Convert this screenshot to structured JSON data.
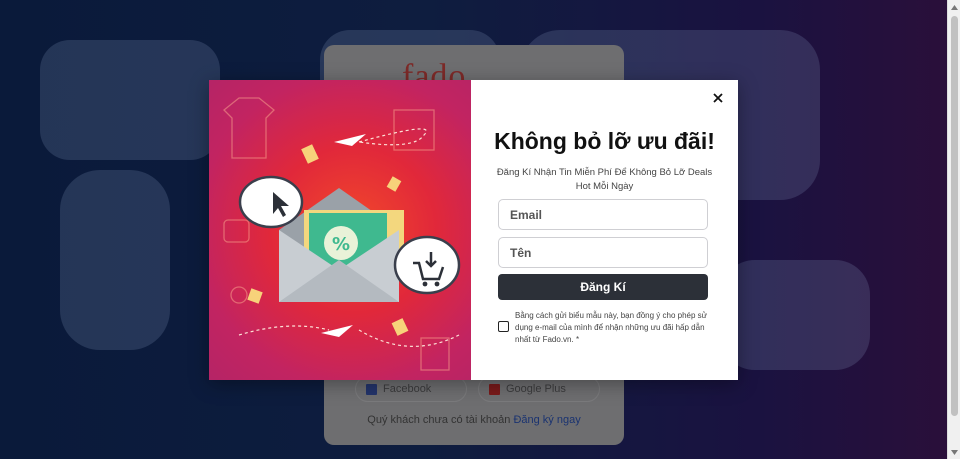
{
  "background": {
    "login_logo": "fado",
    "facebook_label": "Facebook",
    "google_label": "Google Plus",
    "footer_text": "Quý khách chưa có tài khoản",
    "footer_link": "Đăng ký ngay"
  },
  "modal": {
    "title": "Không bỏ lỡ ưu đãi!",
    "subtitle": "Đăng Kí Nhận Tin Miễn Phí Để Không Bỏ Lỡ Deals Hot Mỗi Ngày",
    "email_placeholder": "Email",
    "name_placeholder": "Tên",
    "submit_label": "Đăng Kí",
    "consent_text": "Bằng cách gửi biểu mẫu này, bạn đồng ý cho phép sử dụng e-mail của mình để nhận những ưu đãi hấp dẫn nhất từ Fado.vn. *",
    "art": {
      "percent_symbol": "%"
    }
  },
  "colors": {
    "accent": "#2c3038",
    "art_red": "#e1283a",
    "art_magenta": "#b52466"
  }
}
